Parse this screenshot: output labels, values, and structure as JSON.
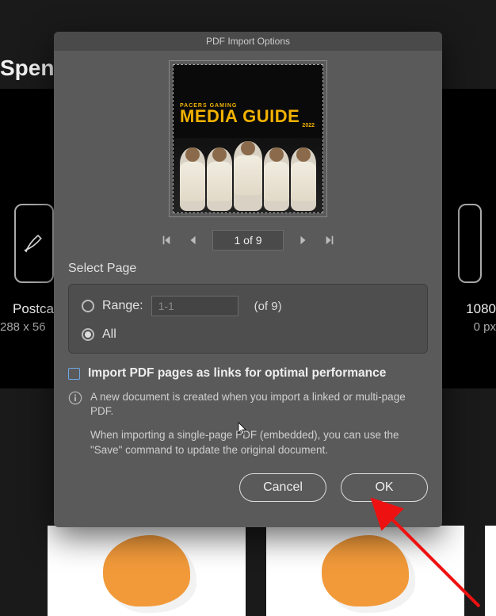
{
  "background": {
    "app_title_fragment": "Spence",
    "preset_left": {
      "label": "Postca",
      "sub": "288 x 56"
    },
    "preset_right": {
      "label_suffix": " 1080",
      "sub_suffix": "0 px"
    }
  },
  "dialog": {
    "title": "PDF Import Options",
    "preview": {
      "line_small": "PACERS GAMING",
      "line_big": "MEDIA GUIDE",
      "year": "2022"
    },
    "pager": {
      "value": "1 of 9"
    },
    "select_page_label": "Select Page",
    "range_label": "Range:",
    "range_value": "1-1",
    "of_text": "(of 9)",
    "all_label": "All",
    "radio_selected": "all",
    "import_as_links_label": "Import PDF pages as links for optimal performance",
    "import_as_links_checked": false,
    "info_p1": "A new document is created when you import a linked or multi-page PDF.",
    "info_p2": "When importing a single-page PDF (embedded), you can use the \"Save\" command to update the original document.",
    "cancel_label": "Cancel",
    "ok_label": "OK"
  }
}
